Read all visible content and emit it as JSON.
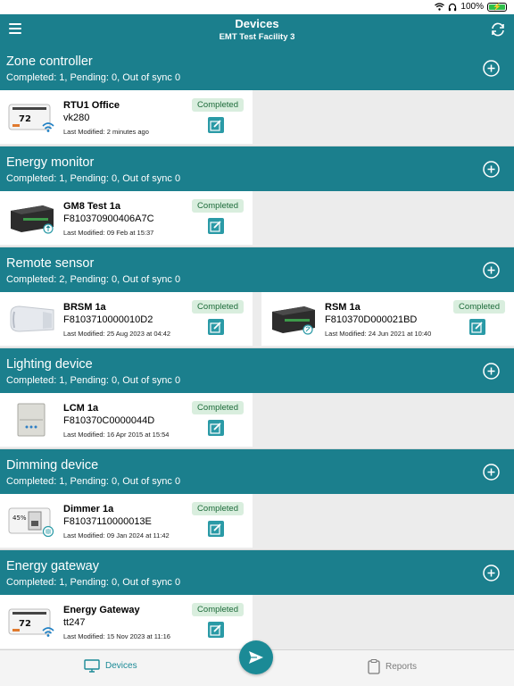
{
  "status_bar": {
    "battery": "100%"
  },
  "header": {
    "title": "Devices",
    "subtitle": "EMT Test Facility 3"
  },
  "sections": [
    {
      "name": "Zone controller",
      "counts": "Completed: 1, Pending: 0, Out of sync 0",
      "cards": [
        {
          "name": "RTU1 Office",
          "id": "vk280",
          "modified": "Last Modified: 2 minutes ago",
          "status": "Completed"
        }
      ]
    },
    {
      "name": "Energy monitor",
      "counts": "Completed: 1, Pending: 0, Out of sync 0",
      "cards": [
        {
          "name": "GM8 Test 1a",
          "id": "F810370900406A7C",
          "modified": "Last Modified: 09 Feb at 15:37",
          "status": "Completed"
        }
      ]
    },
    {
      "name": "Remote sensor",
      "counts": "Completed: 2, Pending: 0, Out of sync 0",
      "cards": [
        {
          "name": "BRSM 1a",
          "id": "F8103710000010D2",
          "modified": "Last Modified: 25 Aug 2023 at 04:42",
          "status": "Completed"
        },
        {
          "name": "RSM 1a",
          "id": "F810370D000021BD",
          "modified": "Last Modified: 24 Jun 2021 at 10:40",
          "status": "Completed"
        }
      ]
    },
    {
      "name": "Lighting device",
      "counts": "Completed: 1, Pending: 0, Out of sync 0",
      "cards": [
        {
          "name": "LCM 1a",
          "id": "F810370C0000044D",
          "modified": "Last Modified: 16 Apr 2015 at 15:54",
          "status": "Completed"
        }
      ]
    },
    {
      "name": "Dimming device",
      "counts": "Completed: 1, Pending: 0, Out of sync 0",
      "cards": [
        {
          "name": "Dimmer 1a",
          "id": "F81037110000013E",
          "modified": "Last Modified: 09 Jan 2024 at 11:42",
          "status": "Completed"
        }
      ]
    },
    {
      "name": "Energy gateway",
      "counts": "Completed: 1, Pending: 0, Out of sync 0",
      "cards": [
        {
          "name": "Energy Gateway",
          "id": "tt247",
          "modified": "Last Modified: 15 Nov 2023 at 11:16",
          "status": "Completed"
        }
      ]
    }
  ],
  "tabs": {
    "devices": "Devices",
    "reports": "Reports"
  },
  "colors": {
    "brand": "#1b7f8d",
    "badge_bg": "#d9eede",
    "badge_text": "#1d6b3a",
    "active_tab": "#1b8a96"
  },
  "icons": [
    "menu-icon",
    "sync-icon",
    "add-circle-icon",
    "edit-icon",
    "send-icon",
    "devices-tab-icon",
    "reports-tab-icon"
  ]
}
